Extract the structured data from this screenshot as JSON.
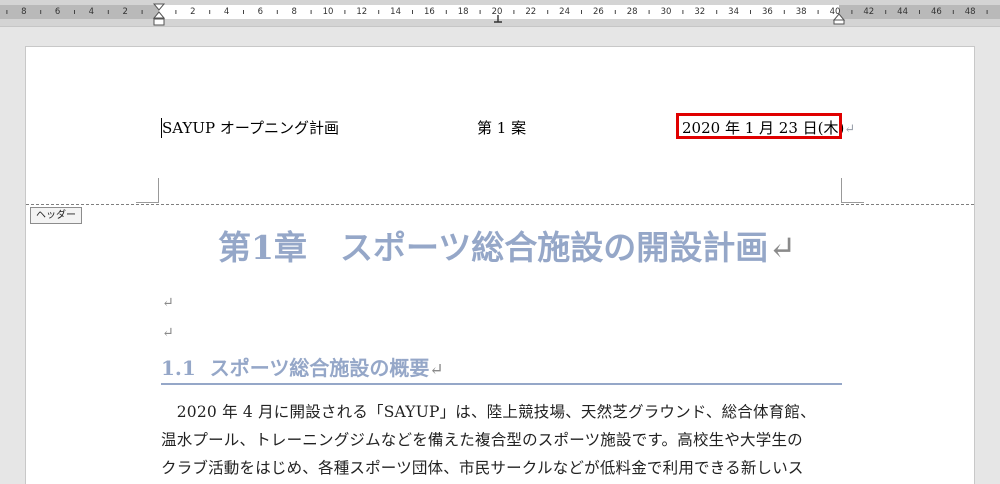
{
  "ruler": {
    "labels": [
      "8",
      "6",
      "4",
      "2",
      "",
      "2",
      "4",
      "6",
      "8",
      "10",
      "12",
      "14",
      "16",
      "18",
      "20",
      "22",
      "24",
      "26",
      "28",
      "30",
      "32",
      "34",
      "36",
      "38",
      "40",
      "42",
      "44",
      "46",
      "48"
    ]
  },
  "header": {
    "left_text": "SAYUP オープニング計画",
    "center_text": "第 1 案",
    "right_text": "2020 年 1 月 23 日(木)",
    "right_mark": "↵",
    "label": "ヘッダー"
  },
  "document": {
    "title": "第1章　スポーツ総合施設の開設計画",
    "paragraph_mark": "↵",
    "heading_number": "1.1",
    "heading_text": "スポーツ総合施設の概要",
    "body_lines": [
      "　2020 年 4 月に開設される「SAYUP」は、陸上競技場、天然芝グラウンド、総合体育館、",
      "温水プール、トレーニングジムなどを備えた複合型のスポーツ施設です。高校生や大学生の",
      "クラブ活動をはじめ、各種スポーツ団体、市民サークルなどが低料金で利用できる新しいス"
    ]
  },
  "colors": {
    "highlight_box": "#e00000",
    "heading": "#95a7c8"
  }
}
